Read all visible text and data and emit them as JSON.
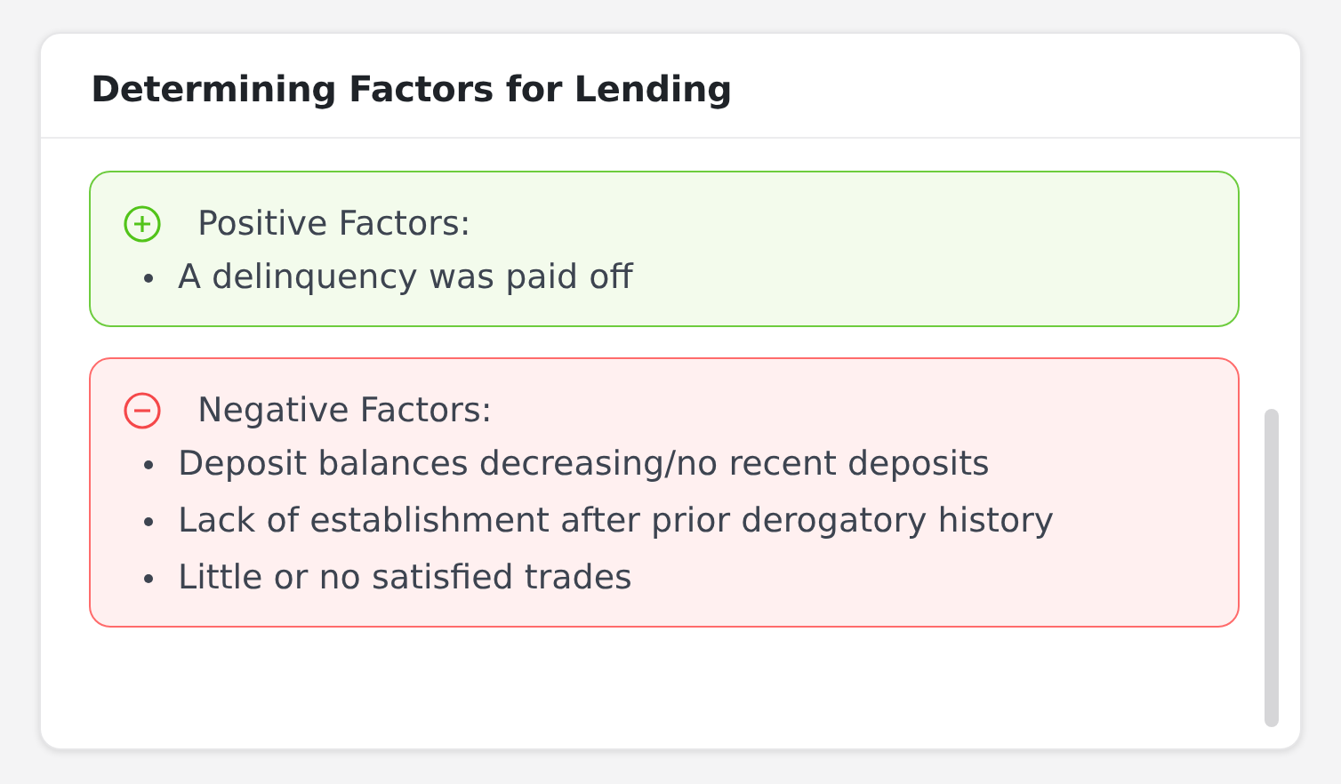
{
  "card": {
    "title": "Determining Factors for Lending"
  },
  "sections": [
    {
      "kind": "positive",
      "heading": "Positive Factors:",
      "items": [
        "A delinquency was paid off"
      ]
    },
    {
      "kind": "negative",
      "heading": "Negative Factors:",
      "items": [
        "Deposit balances decreasing/no recent deposits",
        "Lack of establishment after prior derogatory history",
        "Little or no satisfied trades"
      ]
    }
  ]
}
